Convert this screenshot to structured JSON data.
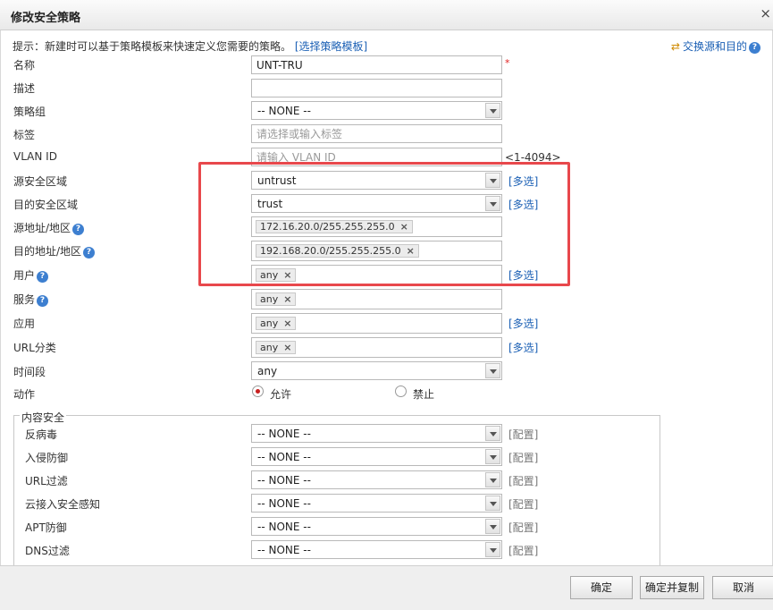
{
  "dialog": {
    "title": "修改安全策略",
    "close_glyph": "×"
  },
  "hint": {
    "text": "提示：新建时可以基于策略模板来快速定义您需要的策略。",
    "link": "[选择策略模板]"
  },
  "swap": {
    "arrows": "⇄",
    "label": "交换源和目的",
    "help": "?"
  },
  "form": {
    "name": {
      "label": "名称",
      "value": "UNT-TRU",
      "required_mark": "*"
    },
    "description": {
      "label": "描述",
      "value": ""
    },
    "policy_group": {
      "label": "策略组",
      "value": "-- NONE --"
    },
    "tag": {
      "label": "标签",
      "placeholder": "请选择或输入标签"
    },
    "vlan": {
      "label": "VLAN ID",
      "placeholder": "请输入 VLAN ID",
      "range": "<1-4094>"
    },
    "src_zone": {
      "label": "源安全区域",
      "value": "untrust",
      "multi": "[多选]"
    },
    "dst_zone": {
      "label": "目的安全区域",
      "value": "trust",
      "multi": "[多选]"
    },
    "src_addr": {
      "label": "源地址/地区",
      "help": "?",
      "tag": "172.16.20.0/255.255.255.0",
      "remove": "×"
    },
    "dst_addr": {
      "label": "目的地址/地区",
      "help": "?",
      "tag": "192.168.20.0/255.255.255.0",
      "remove": "×"
    },
    "user": {
      "label": "用户",
      "help": "?",
      "tag": "any",
      "remove": "×",
      "multi": "[多选]"
    },
    "service": {
      "label": "服务",
      "help": "?",
      "tag": "any",
      "remove": "×"
    },
    "application": {
      "label": "应用",
      "tag": "any",
      "remove": "×",
      "multi": "[多选]"
    },
    "url_category": {
      "label": "URL分类",
      "tag": "any",
      "remove": "×",
      "multi": "[多选]"
    },
    "time_range": {
      "label": "时间段",
      "value": "any"
    },
    "action": {
      "label": "动作",
      "options": [
        "允许",
        "禁止"
      ],
      "selected": "允许"
    }
  },
  "content_security": {
    "legend": "内容安全",
    "rows": [
      {
        "label": "反病毒",
        "value": "-- NONE --",
        "config": "[配置]"
      },
      {
        "label": "入侵防御",
        "value": "-- NONE --",
        "config": "[配置]"
      },
      {
        "label": "URL过滤",
        "value": "-- NONE --",
        "config": "[配置]"
      },
      {
        "label": "云接入安全感知",
        "value": "-- NONE --",
        "config": "[配置]"
      },
      {
        "label": "APT防御",
        "value": "-- NONE --",
        "config": "[配置]"
      },
      {
        "label": "DNS过滤",
        "value": "-- NONE --",
        "config": "[配置]"
      }
    ]
  },
  "buttons": {
    "ok": "确定",
    "ok_copy": "确定并复制",
    "cancel": "取消"
  },
  "colors": {
    "highlight_border": "#e8484c",
    "link": "#1a5fb4",
    "radio_dot": "#c82020"
  }
}
